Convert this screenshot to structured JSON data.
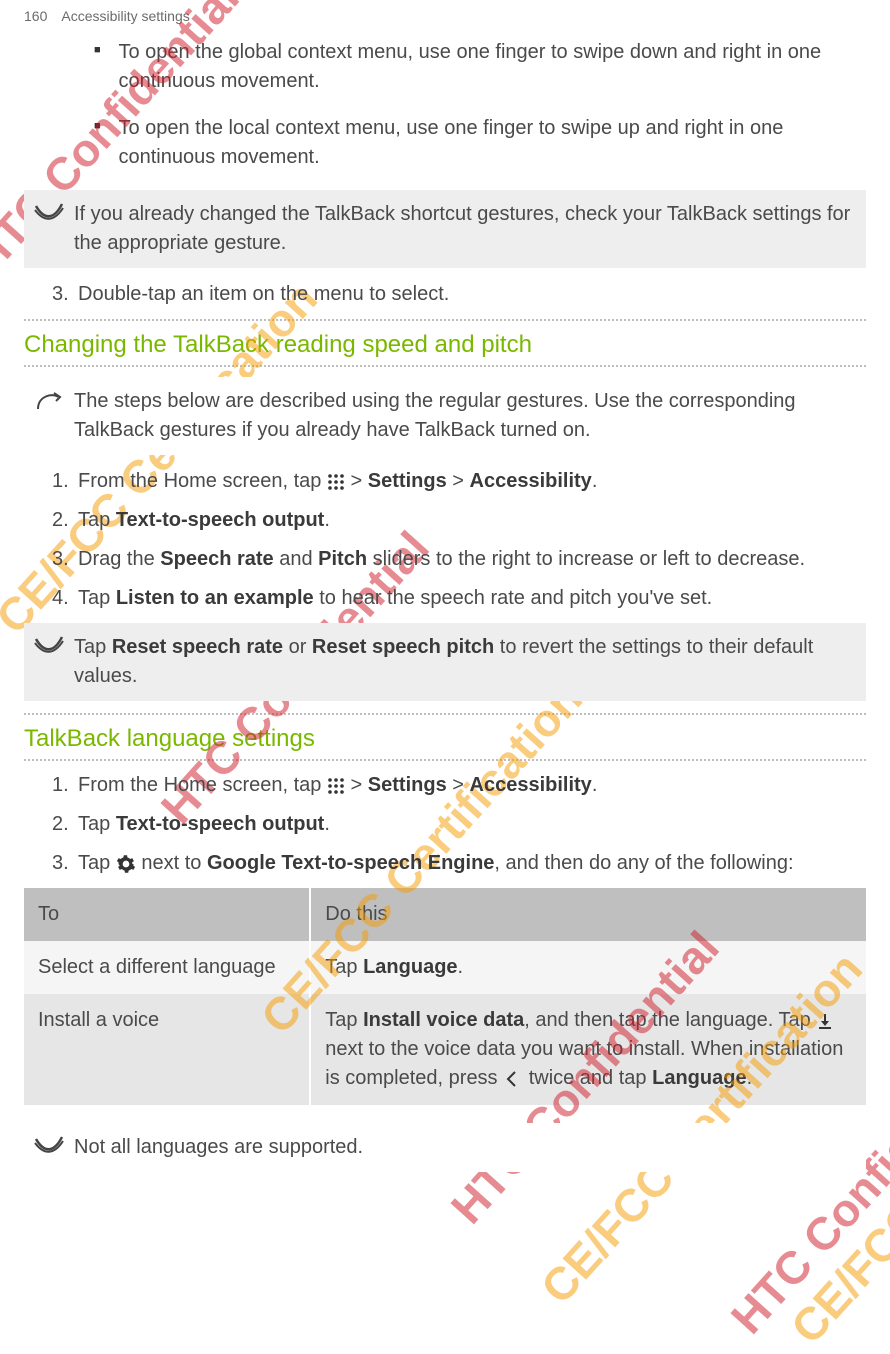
{
  "header": {
    "page_number": "160",
    "section": "Accessibility settings"
  },
  "intro_bullets": [
    "To open the global context menu, use one finger to swipe down and right in one continuous movement.",
    "To open the local context menu, use one finger to swipe up and right in one continuous movement."
  ],
  "note1": "If you already changed the TalkBack shortcut gestures, check your TalkBack settings for the appropriate gesture.",
  "intro_step3": {
    "num": "3.",
    "text": "Double-tap an item on the menu to select."
  },
  "section1": {
    "title": "Changing the TalkBack reading speed and pitch",
    "tip": "The steps below are described using the regular gestures. Use the corresponding TalkBack gestures if you already have TalkBack turned on.",
    "steps": [
      {
        "num": "1.",
        "prefix": "From the Home screen, tap ",
        "mid": " > ",
        "b1": "Settings",
        "b2": "Accessibility",
        "suffix": "."
      },
      {
        "num": "2.",
        "prefix": "Tap ",
        "b1": "Text-to-speech output",
        "suffix": "."
      },
      {
        "num": "3.",
        "prefix": "Drag the ",
        "b1": "Speech rate",
        "mid": " and ",
        "b2": "Pitch",
        "suffix": " sliders to the right to increase or left to decrease."
      },
      {
        "num": "4.",
        "prefix": "Tap ",
        "b1": "Listen to an example",
        "suffix": " to hear the speech rate and pitch you've set."
      }
    ],
    "note": {
      "prefix": "Tap ",
      "b1": "Reset speech rate",
      "mid": " or ",
      "b2": "Reset speech pitch",
      "suffix": " to revert the settings to their default values."
    }
  },
  "section2": {
    "title": "TalkBack language settings",
    "steps": [
      {
        "num": "1.",
        "prefix": "From the Home screen, tap ",
        "mid": " > ",
        "b1": "Settings",
        "b2": "Accessibility",
        "suffix": "."
      },
      {
        "num": "2.",
        "prefix": "Tap ",
        "b1": "Text-to-speech output",
        "suffix": "."
      },
      {
        "num": "3.",
        "prefix": "Tap ",
        "mid": " next to ",
        "b1": "Google Text-to-speech Engine",
        "suffix": ", and then do any of the following:"
      }
    ],
    "table": {
      "headers": [
        "To",
        "Do this"
      ],
      "rows": [
        {
          "to": "Select a different language",
          "do_prefix": "Tap ",
          "do_b1": "Language",
          "do_suffix": "."
        },
        {
          "to": "Install a voice",
          "do_prefix": "Tap ",
          "do_b1": "Install voice data",
          "do_mid1": ", and then tap the language. Tap ",
          "do_mid2": " next to the voice data you want to install. When installation is completed, press ",
          "do_mid3": " twice and tap ",
          "do_b2": "Language",
          "do_suffix": "."
        }
      ]
    },
    "footnote": "Not all languages are supported."
  },
  "watermarks": {
    "conf": "HTC Confidential",
    "cert": "CE/FCC Certification"
  }
}
